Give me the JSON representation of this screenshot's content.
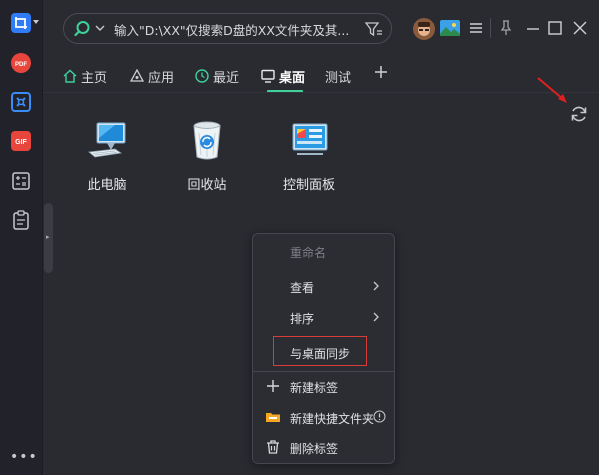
{
  "search": {
    "placeholder": "输入\"D:\\XX\"仅搜索D盘的XX文件夹及其..."
  },
  "tabs": [
    {
      "label": "主页",
      "icon": "home-icon"
    },
    {
      "label": "应用",
      "icon": "apps-icon"
    },
    {
      "label": "最近",
      "icon": "clock-icon"
    },
    {
      "label": "桌面",
      "icon": "monitor-icon",
      "active": true
    },
    {
      "label": "测试"
    }
  ],
  "desktop_items": [
    {
      "label": "此电脑",
      "icon": "computer-icon"
    },
    {
      "label": "回收站",
      "icon": "recycle-bin-icon"
    },
    {
      "label": "控制面板",
      "icon": "control-panel-icon"
    }
  ],
  "context_menu": {
    "items": [
      {
        "label": "重命名",
        "disabled": true
      },
      {
        "label": "查看",
        "submenu": true
      },
      {
        "label": "排序",
        "submenu": true
      },
      {
        "label": "与桌面同步",
        "highlighted": true
      },
      {
        "label": "新建标签",
        "icon": "plus-icon"
      },
      {
        "label": "新建快捷文件夹",
        "icon": "folder-icon",
        "info": true
      },
      {
        "label": "删除标签",
        "icon": "trash-icon"
      }
    ]
  },
  "left_rail": {
    "more_label": "•••",
    "icons": [
      "screenshot-icon",
      "pdf-icon",
      "scan-icon",
      "gif-icon",
      "calculator-icon",
      "clipboard-icon"
    ]
  },
  "colors": {
    "accent": "#3ed19a",
    "background": "#2a2b31",
    "highlight_box": "#d93a3a",
    "annotation_arrow": "#e02020"
  }
}
